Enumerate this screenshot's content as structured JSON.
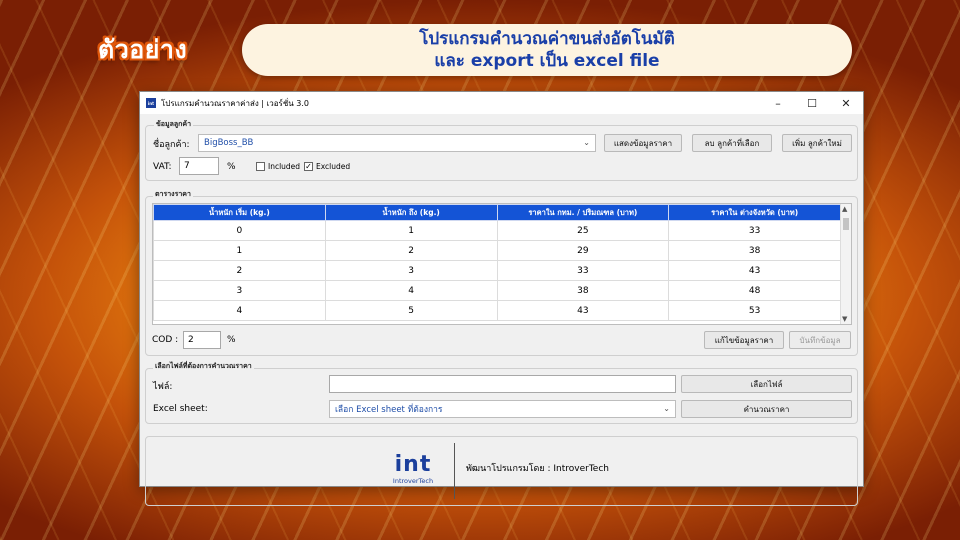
{
  "slide": {
    "badge": "ตัวอย่าง",
    "headline_line1": "โปรแกรมคำนวณค่าขนส่งอัตโนมัติ",
    "headline_line2": "และ export เป็น excel file"
  },
  "window": {
    "icon_text": "int",
    "title": "โปรแกรมคำนวณราคาค่าส่ง | เวอร์ชั่น 3.0",
    "controls": {
      "minimize": "–",
      "maximize": "☐",
      "close": "✕"
    }
  },
  "customer_section": {
    "legend": "ข้อมูลลูกค้า",
    "customer_label": "ชื่อลูกค้า:",
    "customer_value": "BigBoss_BB",
    "show_price_button": "แสดงข้อมูลราคา",
    "delete_customer_button": "ลบ ลูกค้าที่เลือก",
    "add_customer_button": "เพิ่ม ลูกค้าใหม่",
    "vat_label": "VAT:",
    "vat_value": "7",
    "vat_unit": "%",
    "included_label": "Included",
    "included_checked": false,
    "excluded_label": "Excluded",
    "excluded_checked": true
  },
  "price_table": {
    "legend": "ตารางราคา",
    "columns": [
      "น้ำหนัก เริ่ม (kg.)",
      "น้ำหนัก ถึง (kg.)",
      "ราคาใน กทม. / ปริมณฑล (บาท)",
      "ราคาใน ต่างจังหวัด (บาท)"
    ],
    "rows": [
      [
        "0",
        "1",
        "25",
        "33"
      ],
      [
        "1",
        "2",
        "29",
        "38"
      ],
      [
        "2",
        "3",
        "33",
        "43"
      ],
      [
        "3",
        "4",
        "38",
        "48"
      ],
      [
        "4",
        "5",
        "43",
        "53"
      ]
    ],
    "cod_label": "COD :",
    "cod_value": "2",
    "cod_unit": "%",
    "edit_button": "แก้ไขข้อมูลราคา",
    "save_button": "บันทึกข้อมูล"
  },
  "file_section": {
    "legend": "เลือกไฟล์ที่ต้องการคำนวณราคา",
    "file_label": "ไฟล์:",
    "file_value": "",
    "choose_file_button": "เลือกไฟล์",
    "sheet_label": "Excel sheet:",
    "sheet_placeholder": "เลือก Excel sheet ที่ต้องการ",
    "calculate_button": "คำนวณราคา"
  },
  "footer": {
    "logo_mark": "int",
    "logo_sub": "IntroverTech",
    "developer_text": "พัฒนาโปรแกรมโดย : IntroverTech"
  },
  "colors": {
    "table_header": "#1454d6",
    "brand_blue": "#1b3f9c",
    "banner_text": "#1a3fa8",
    "badge_outline": "#e0570a"
  }
}
